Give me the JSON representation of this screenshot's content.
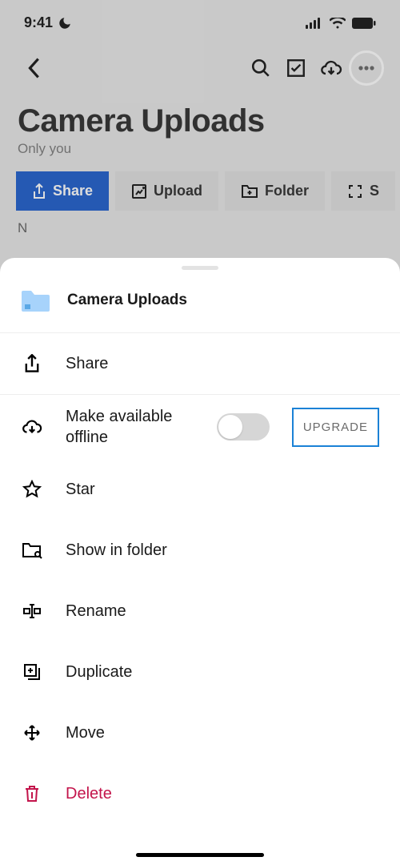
{
  "status": {
    "time": "9:41"
  },
  "header": {
    "title": "Camera Uploads",
    "subtitle": "Only you"
  },
  "actions": {
    "share": "Share",
    "upload": "Upload",
    "folder": "Folder",
    "scan": "S"
  },
  "sheet": {
    "title": "Camera Uploads",
    "share": "Share",
    "offline": "Make available offline",
    "upgrade": "UPGRADE",
    "star": "Star",
    "show": "Show in folder",
    "rename": "Rename",
    "duplicate": "Duplicate",
    "move": "Move",
    "delete": "Delete"
  },
  "colors": {
    "primary": "#0a4fc7",
    "folder": "#a7d3fb",
    "danger": "#c3144b",
    "upgrade_border": "#1b82d6"
  }
}
